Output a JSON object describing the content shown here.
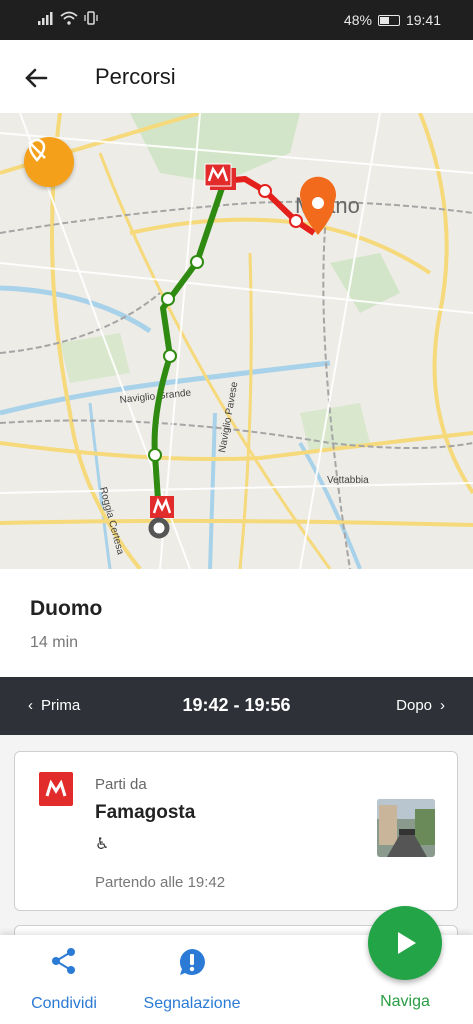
{
  "status_bar": {
    "battery": "48%",
    "time": "19:41"
  },
  "header": {
    "title": "Percorsi"
  },
  "map": {
    "city_label": "Milano",
    "street_labels": [
      "Naviglio Grande",
      "Naviglio Pavese",
      "Roggia Certesa",
      "Vettabbia"
    ]
  },
  "destination": {
    "name": "Duomo",
    "duration": "14 min"
  },
  "time_bar": {
    "prev_label": "Prima",
    "range": "19:42 - 19:56",
    "next_label": "Dopo"
  },
  "step": {
    "label": "Parti da",
    "station": "Famagosta",
    "accessibility": "♿",
    "departure": "Partendo alle 19:42"
  },
  "bottom_nav": {
    "share": "Condividi",
    "report": "Segnalazione",
    "navigate": "Naviga"
  },
  "colors": {
    "metro_green": "#2f8a12",
    "route_red": "#e4201c",
    "accent_orange": "#f5a01a",
    "nav_blue": "#2b7bd6",
    "fab_green": "#22a447"
  }
}
